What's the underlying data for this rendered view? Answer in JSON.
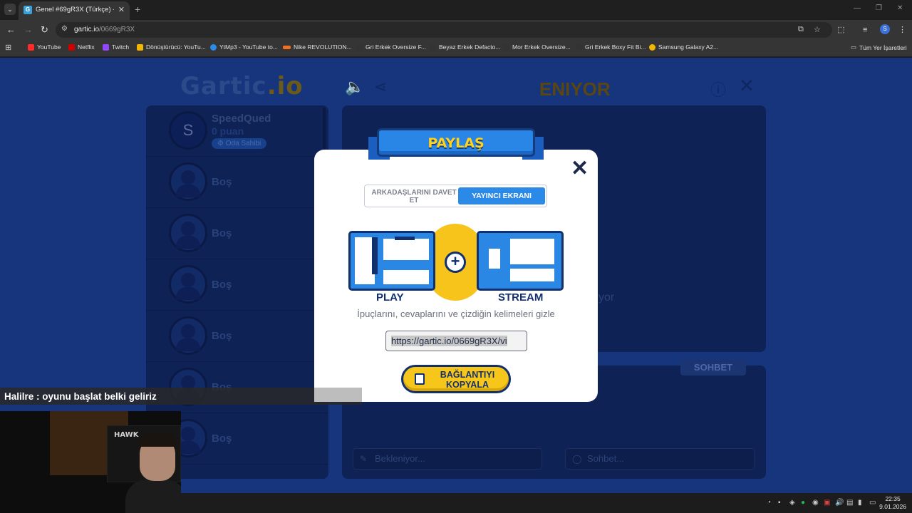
{
  "browser": {
    "tab_title": "Genel #69gR3X (Türkçe) - Gartic.io",
    "tab_favicon": "G",
    "url_host": "gartic.io",
    "url_path": "/0669gR3X",
    "profile_initial": "S",
    "bookmarks": [
      {
        "label": "YouTube",
        "color": "#ff2a2a"
      },
      {
        "label": "Netflix",
        "color": "#d10000"
      },
      {
        "label": "Twitch",
        "color": "#9146ff"
      },
      {
        "label": "Dönüştürücü: YouTu...",
        "color": "#f2b600"
      },
      {
        "label": "YtMp3 - YouTube to...",
        "color": "#2a8be8"
      },
      {
        "label": "Nike REVOLUTION...",
        "color": "#f07020"
      },
      {
        "label": "Gri Erkek Oversize F...",
        "color": "#333333"
      },
      {
        "label": "Beyaz Erkek Defacto...",
        "color": "#333333"
      },
      {
        "label": "Mor Erkek Oversize...",
        "color": "#333333"
      },
      {
        "label": "Gri Erkek Boxy Fit Bi...",
        "color": "#333333"
      },
      {
        "label": "Samsung Galaxy A2...",
        "color": "#f2b600"
      }
    ],
    "all_bookmarks": "Tüm Yer İşaretleri"
  },
  "game": {
    "logo_main": "Gartic",
    "logo_accent": ".io",
    "players": [
      {
        "initial": "S",
        "name": "SpeedQued",
        "score": "0 puan",
        "badge": "Oda Sahibi"
      },
      {
        "name": "Boş"
      },
      {
        "name": "Boş"
      },
      {
        "name": "Boş"
      },
      {
        "name": "Boş"
      },
      {
        "name": "Boş"
      },
      {
        "name": "Boş"
      }
    ],
    "waiting_title": "ENIYOR",
    "waiting_sub": "yor",
    "chat_tab": "SOHBET",
    "answer_placeholder": "Bekleniyor...",
    "chat_placeholder": "Sohbet..."
  },
  "modal": {
    "title": "PAYLAŞ",
    "tab_invite": "ARKADAŞLARINI DAVET ET",
    "tab_stream": "YAYINCI EKRANI",
    "label_play": "PLAY",
    "label_stream": "STREAM",
    "hint": "İpuçlarını, cevaplarını ve çizdiğin kelimeleri gizle",
    "link": "https://gartic.io/0669gR3X/vi",
    "copy_button": "BAĞLANTIYI KOPYALA"
  },
  "overlay": {
    "chat_message": "Halilre : oyunu başlat belki geliriz",
    "webcam_brand": "HAWK"
  },
  "taskbar": {
    "time": "22:35",
    "date": "9.01.2026"
  },
  "colors": {
    "page_bg": "#16357d",
    "modal_accent": "#2b8ae8",
    "button_yellow": "#f6c61b"
  }
}
